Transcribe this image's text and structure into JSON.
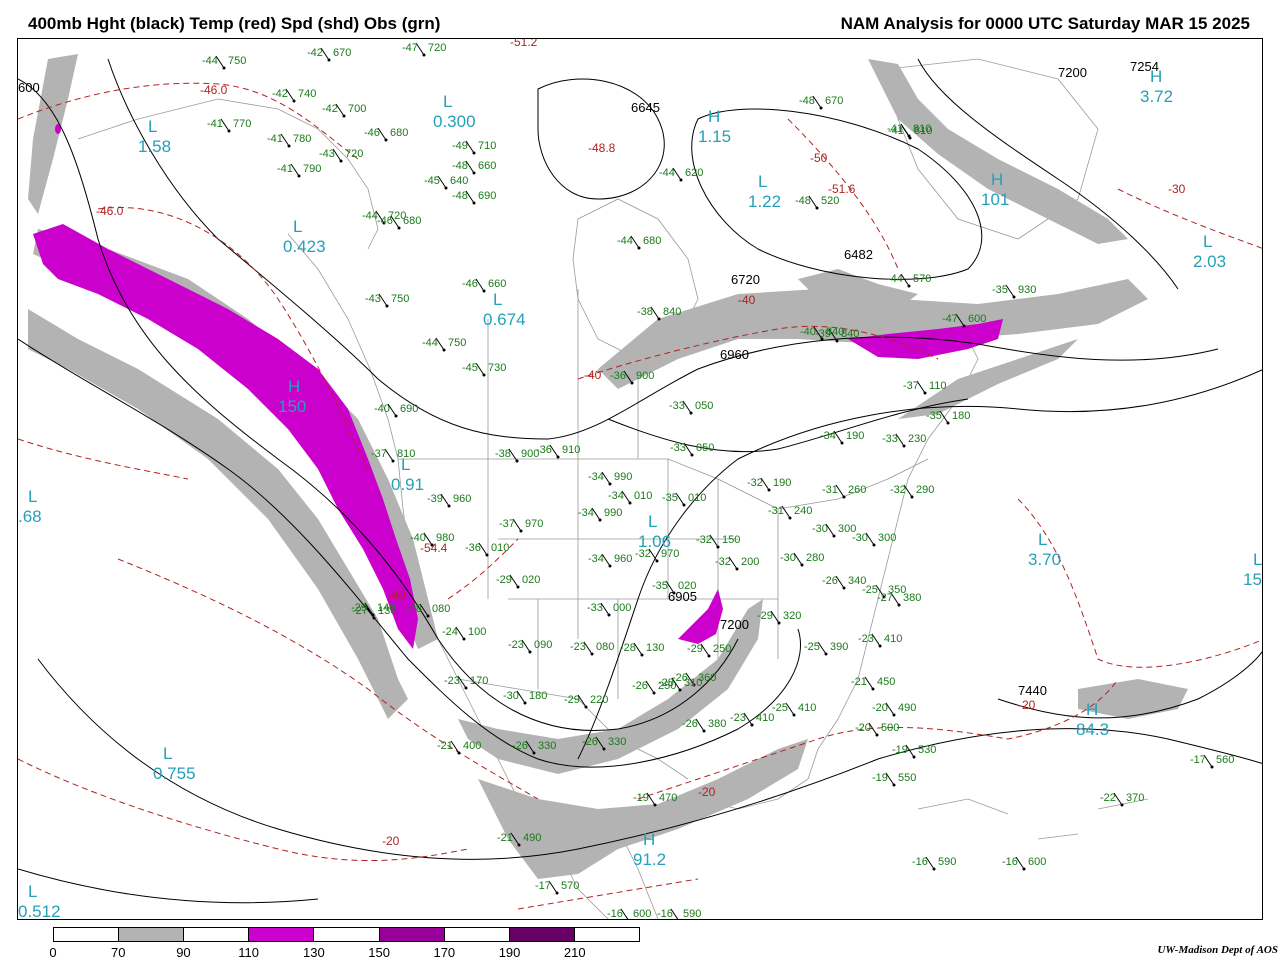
{
  "title_left": "400mb Hght (black) Temp (red) Spd (shd) Obs (grn)",
  "title_right": "NAM Analysis for 0000 UTC Saturday  MAR 15 2025",
  "credit": "UW-Madison   Dept of AOS",
  "colors": {
    "shade_70": "#b3b3b3",
    "shade_110": "#cc00cc",
    "shade_150": "#990099",
    "shade_190": "#660066",
    "height_contour": "#000000",
    "temp_contour": "#b22222",
    "obs_text": "#1a7a1a",
    "center_label": "#26a0b8",
    "geography": "#9a9a9a"
  },
  "colorbar": {
    "ticks": [
      "0",
      "70",
      "90",
      "110",
      "130",
      "150",
      "170",
      "190",
      "210"
    ],
    "segments": [
      "#ffffff",
      "#b3b3b3",
      "#ffffff",
      "#cc00cc",
      "#ffffff",
      "#990099",
      "#ffffff",
      "#660066",
      "#ffffff"
    ]
  },
  "pressure_centers": [
    {
      "letter": "L",
      "value": "1.58"
    },
    {
      "letter": "L",
      "value": "0.423"
    },
    {
      "letter": "L",
      "value": "0.300"
    },
    {
      "letter": "L",
      "value": "0.674"
    },
    {
      "letter": "H",
      "value": "150"
    },
    {
      "letter": "L",
      "value": "0.91"
    },
    {
      "letter": "L",
      "value": "1.06"
    },
    {
      "letter": "L",
      "value": "1.22"
    },
    {
      "letter": "H",
      "value": "1.15"
    },
    {
      "letter": "H",
      "value": "3.72"
    },
    {
      "letter": "H",
      "value": "101"
    },
    {
      "letter": "L",
      "value": "2.03"
    },
    {
      "letter": "L",
      "value": "3.70"
    },
    {
      "letter": "L",
      "value": "0.755"
    },
    {
      "letter": "L",
      "value": "0.512"
    },
    {
      "letter": "H",
      "value": "91.2"
    },
    {
      "letter": "H",
      "value": "84.3"
    },
    {
      "letter": "L",
      "value": "15"
    },
    {
      "letter": "L",
      "value": ".68"
    }
  ],
  "height_labels": [
    "7200",
    "7254",
    "6645",
    "6482",
    "6720",
    "6960",
    "6905",
    "7200",
    "7440",
    "600"
  ],
  "temp_labels": [
    "-46.0",
    "-46.0",
    "-51.2",
    "-48.8",
    "-51.6",
    "-50",
    "-40",
    "-40",
    "-30",
    "-20",
    "-20",
    "-20",
    "-54.4",
    "-40"
  ],
  "observations": [
    "-44 750",
    "-42 670",
    "-47 720",
    "-42 740",
    "-42 700",
    "-41 770",
    "-41 780",
    "-41 790",
    "-43 720",
    "-46 680",
    "-49 710",
    "-45 640",
    "-48 660",
    "-48 690",
    "-44 680",
    "-44 620",
    "-48 670",
    "-48 520",
    "-41 810",
    "-44 720",
    "-46 680",
    "-43 750",
    "-44 750",
    "-45 730",
    "-46 660",
    "-38 840",
    "-36 900",
    "-33 050",
    "-33 050",
    "-39 840",
    "-40 690",
    "-37 810",
    "-38 900",
    "-36 910",
    "-34 990",
    "-34 010",
    "-35 010",
    "-32 190",
    "-31 260",
    "-32 290",
    "-39 960",
    "-40 980",
    "-36 010",
    "-37 970",
    "-34 990",
    "-34 960",
    "-32 970",
    "-31 240",
    "-30 300",
    "-30 300",
    "-30 280",
    "-32 200",
    "-32 150",
    "-29 020",
    "-28 080",
    "-24 100",
    "-23 090",
    "-23 080",
    "-28 130",
    "-29 250",
    "-33 000",
    "-35 020",
    "-29 320",
    "-26 340",
    "-25 350",
    "-27 380",
    "-23 410",
    "-21 450",
    "-20 490",
    "-20 500",
    "-19 530",
    "-19 550",
    "-17 560",
    "-22 370",
    "-26 360",
    "-25 390",
    "-25 410",
    "-26 380",
    "-23 410",
    "-19 470",
    "-23 170",
    "-30 180",
    "-29 220",
    "-26 250",
    "-28 310",
    "-26 330",
    "-26 330",
    "-21 400",
    "-21 490",
    "-17 570",
    "-16 600",
    "-16 590",
    "-16 590",
    "-16 600",
    "-29 140",
    "-27 130",
    "-37 110",
    "-34 190",
    "-35 180",
    "-33 230",
    "-35 930",
    "-41 810",
    "-47 600",
    "-44 570",
    "-40 840"
  ]
}
